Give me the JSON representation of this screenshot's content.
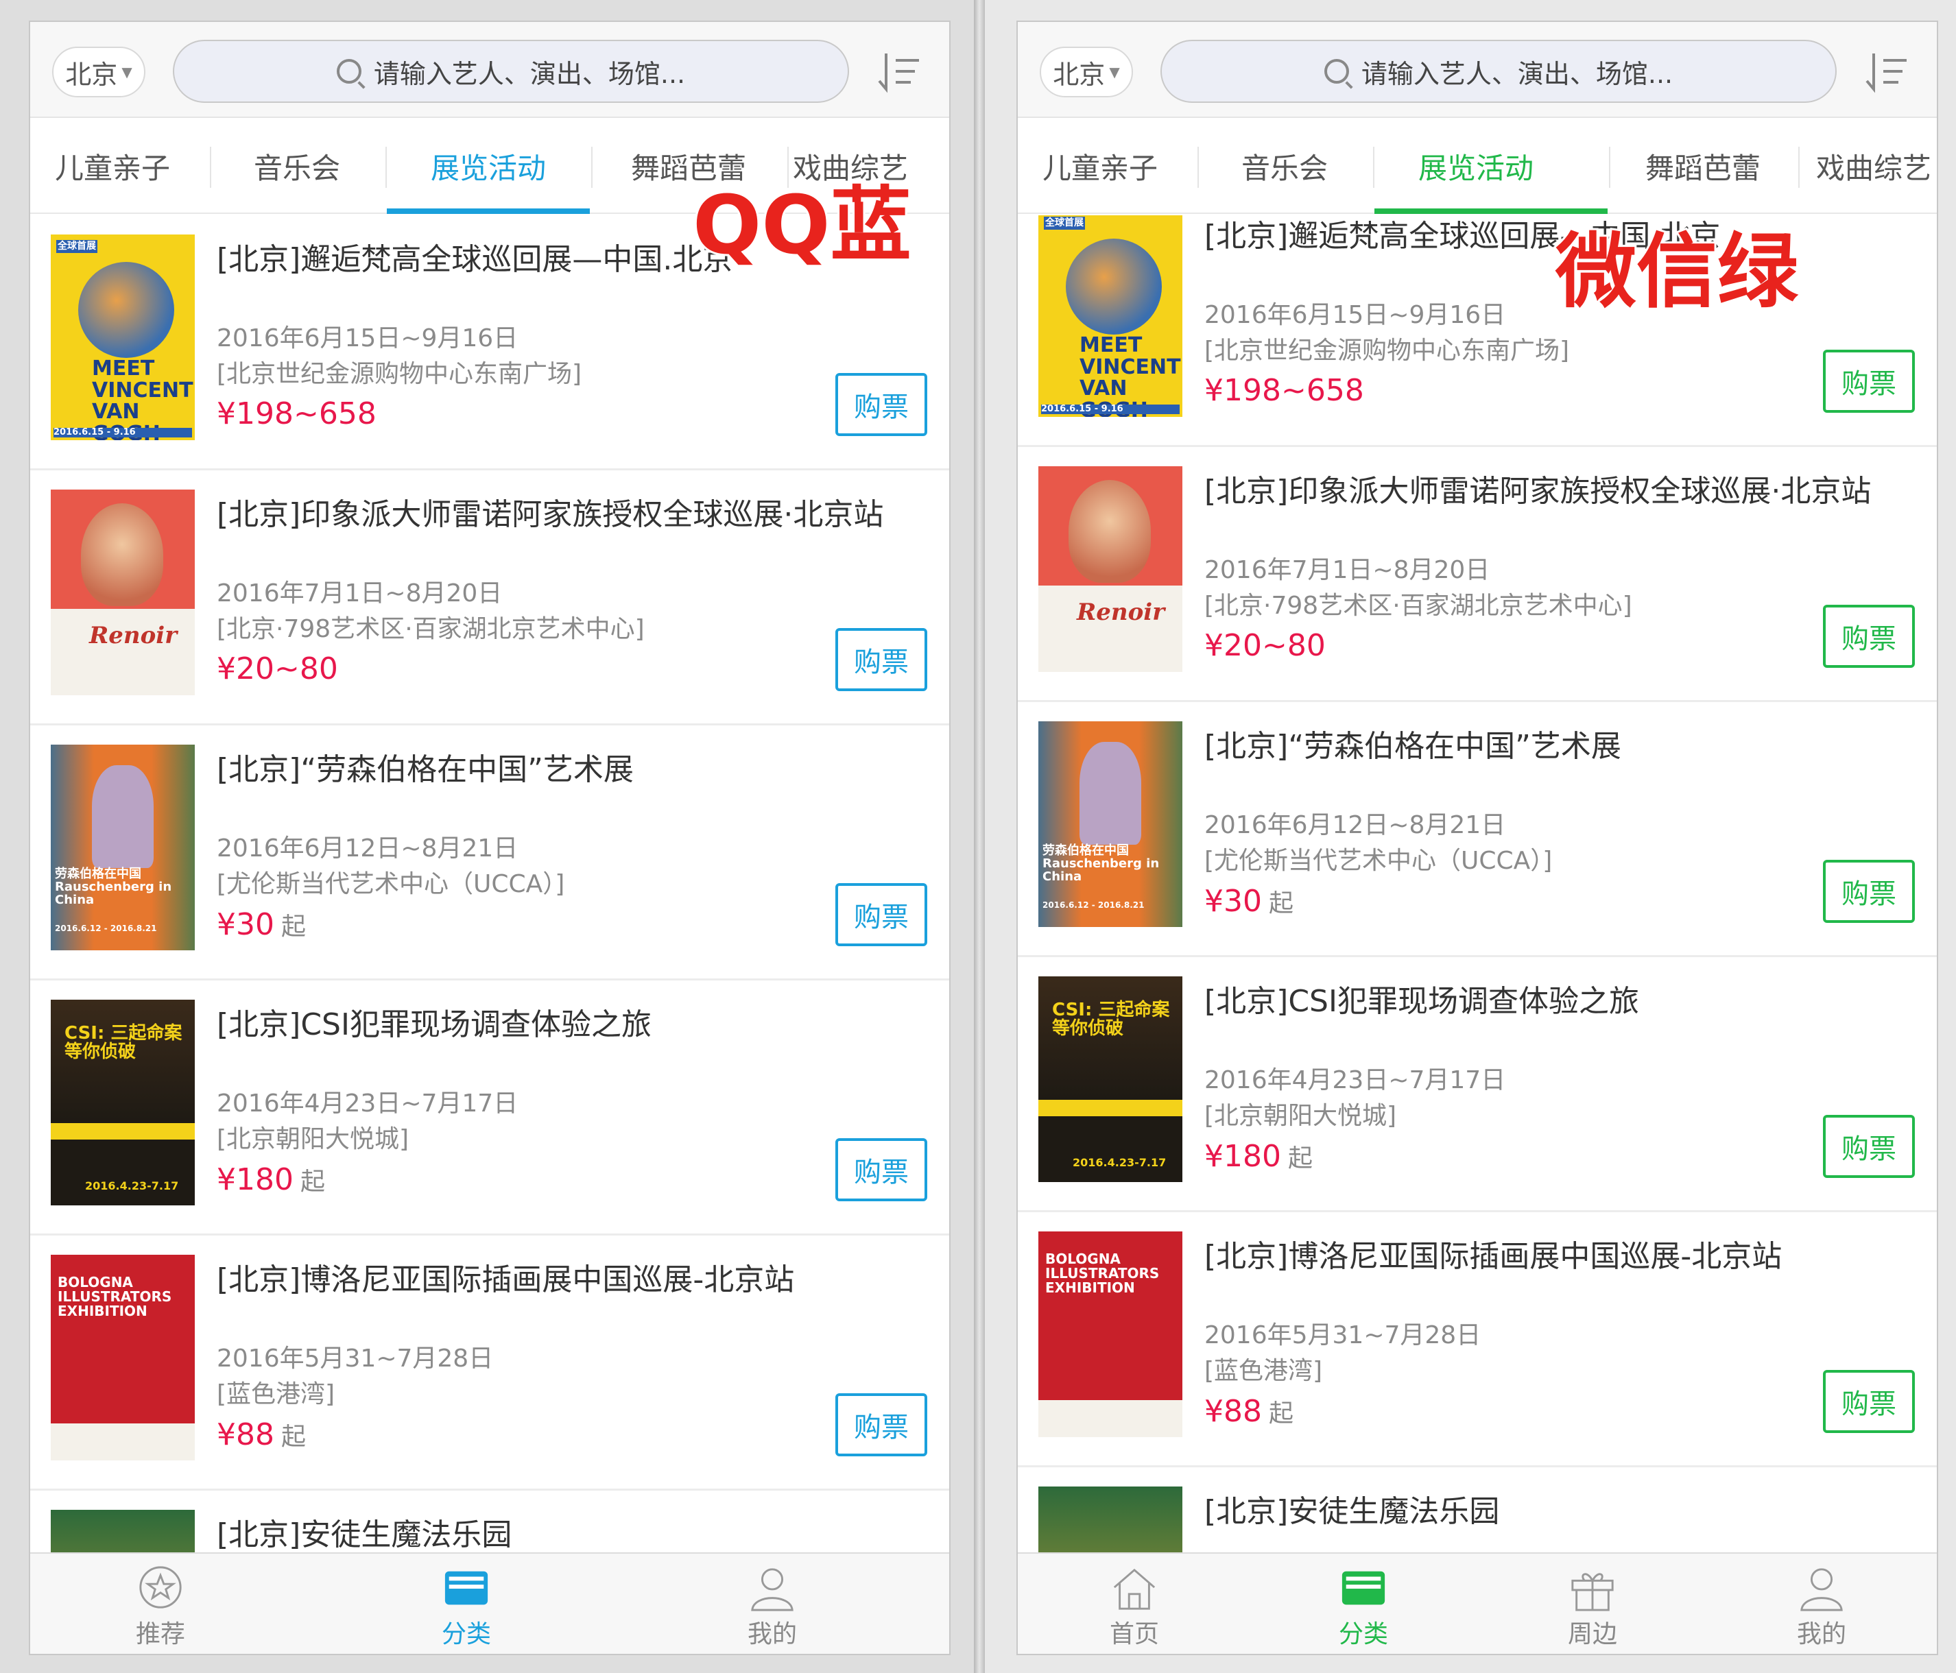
{
  "left": {
    "city": "北京",
    "search_placeholder": "请输入艺人、演出、场馆...",
    "tabs": [
      "儿童亲子",
      "音乐会",
      "展览活动",
      "舞蹈芭蕾",
      "戏曲综艺"
    ],
    "active_tab": "展览活动",
    "overlay_label": "QQ蓝",
    "accent_color": "#1aa0dc",
    "nav": [
      "推荐",
      "分类",
      "我的"
    ],
    "partial_title": "[北京]安徒生魔法乐园"
  },
  "right": {
    "city": "北京",
    "search_placeholder": "请输入艺人、演出、场馆...",
    "tabs": [
      "儿童亲子",
      "音乐会",
      "展览活动",
      "舞蹈芭蕾",
      "戏曲综艺"
    ],
    "active_tab": "展览活动",
    "overlay_label": "微信绿",
    "accent_color": "#21b84a",
    "nav": [
      "首页",
      "分类",
      "周边",
      "我的"
    ],
    "partial_title": "[北京]安徒生魔法乐园"
  },
  "buy_label": "购票",
  "items": [
    {
      "title": "[北京]邂逅梵高全球巡回展—中国.北京",
      "date": "2016年6月15日~9月16日",
      "venue": "[北京世纪金源购物中心东南广场]",
      "price": "¥198~658",
      "from": "",
      "poster_text": "MEET VINCENT VAN GOGH",
      "poster_date": "2016.6.15 - 9.16"
    },
    {
      "title": "[北京]印象派大师雷诺阿家族授权全球巡展·北京站",
      "date": "2016年7月1日~8月20日",
      "venue": "[北京·798艺术区·百家湖北京艺术中心]",
      "price": "¥20~80",
      "from": "",
      "poster_text": "Renoir",
      "poster_date": ""
    },
    {
      "title": "[北京]“劳森伯格在中国”艺术展",
      "date": "2016年6月12日~8月21日",
      "venue": "[尤伦斯当代艺术中心（UCCA）]",
      "price": "¥30",
      "from": "起",
      "poster_text": "劳森伯格在中国 Rauschenberg in China",
      "poster_date": "2016.6.12 - 2016.8.21"
    },
    {
      "title": "[北京]CSI犯罪现场调查体验之旅",
      "date": "2016年4月23日~7月17日",
      "venue": "[北京朝阳大悦城]",
      "price": "¥180",
      "from": "起",
      "poster_text": "CSI: 三起命案 等你侦破",
      "poster_date": "2016.4.23-7.17"
    },
    {
      "title": "[北京]博洛尼亚国际插画展中国巡展-北京站",
      "date": "2016年5月31~7月28日",
      "venue": "[蓝色港湾]",
      "price": "¥88",
      "from": "起",
      "poster_text": "BOLOGNA ILLUSTRATORS EXHIBITION",
      "poster_date": ""
    }
  ]
}
